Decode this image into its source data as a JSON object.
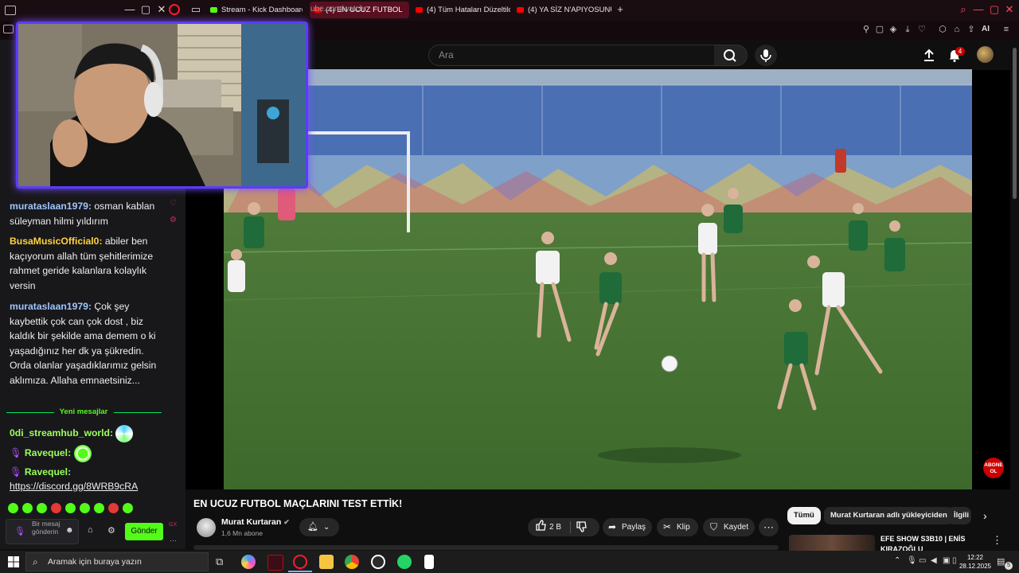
{
  "tabs": [
    {
      "label": "Stream - Kick Dashboard",
      "active": false,
      "color": "#53fc18"
    },
    {
      "label": "(4) EN UCUZ FUTBOL",
      "active": true,
      "color": "#ff0000"
    },
    {
      "label": "(4) Tüm Hataları Düzeltildi",
      "active": false,
      "color": "#ff0000"
    },
    {
      "label": "(4) YA SİZ N'APIYOSUNUZ",
      "active": false,
      "color": "#ff0000"
    }
  ],
  "address": {
    "url": "ube.com/watch",
    "ai_label": "AI"
  },
  "youtube": {
    "search_placeholder": "Ara",
    "notification_count": "4",
    "video_title": "EN UCUZ FUTBOL MAÇLARINI TEST ETTİK!",
    "channel_name": "Murat Kurtaran",
    "subscriber_count": "1,6 Mn abone",
    "like_count": "2 B",
    "share_label": "Paylaş",
    "clip_label": "Klip",
    "save_label": "Kaydet",
    "subscribe_badge": "ABONE OL",
    "chips": [
      "Tümü",
      "Murat Kurtaran adlı yükleyiciden",
      "İlgili"
    ],
    "related_title_1": "EFE SHOW S3B10 | ENİS",
    "related_title_2": "KIRAZOĞLU"
  },
  "chat": {
    "messages": [
      {
        "user": "murataslaan1979",
        "color": "#9ec5ff",
        "text": "osman kablan süleyman hilmi yıldırım"
      },
      {
        "user": "BusaMusicOfficial0",
        "color": "#ffd23c",
        "text": "abiler ben kaçıyorum allah tüm şehitlerimize rahmet geride kalanlara kolaylık versin"
      },
      {
        "user": "murataslaan1979",
        "color": "#9ec5ff",
        "text": "Çok şey kaybettik çok can çok dost , biz kaldık bir şekilde ama demem o ki yaşadığınız her dk ya şükredin. Orda olanlar yaşadıklarımız gelsin aklımıza. Allaha emnaetsiniz..."
      }
    ],
    "new_messages_label": "Yeni mesajlar",
    "after": [
      {
        "user": "0di_streamhub_world",
        "color": "#9dff5a",
        "text": ""
      },
      {
        "user": "Ravequel",
        "color": "#9dff5a",
        "text": ""
      },
      {
        "user": "Ravequel",
        "color": "#9dff5a",
        "text": "https://discord.gg/8WRB9cRA"
      }
    ],
    "input_placeholder": "Bir mesaj gönderin",
    "send_label": "Gönder",
    "gx_label": "GX"
  },
  "taskbar": {
    "search_placeholder": "Aramak için buraya yazın",
    "time": "12:22",
    "date": "28.12.2025",
    "notif_count": "5"
  }
}
